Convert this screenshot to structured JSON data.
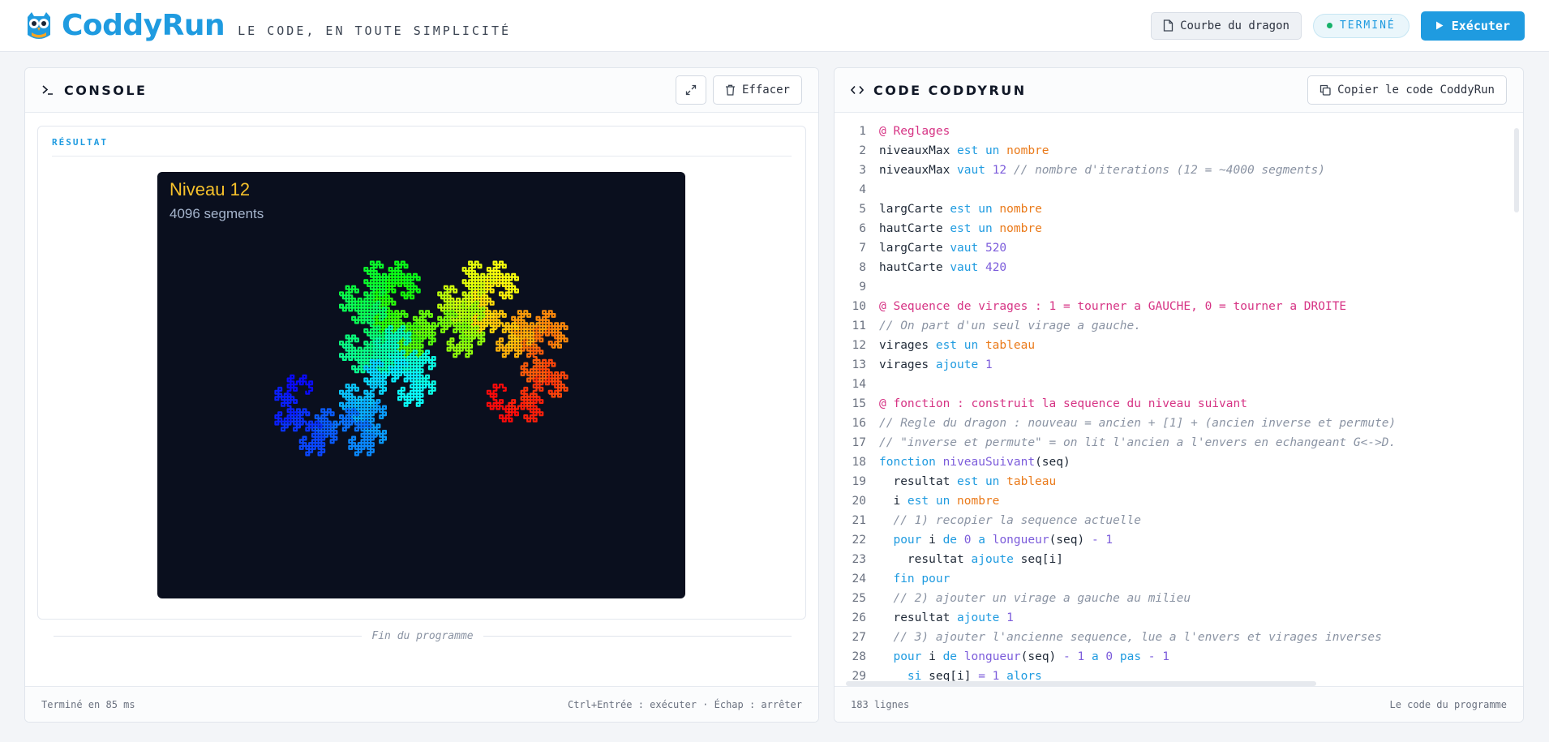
{
  "header": {
    "brand": "CoddyRun",
    "tagline": "LE CODE, EN TOUTE SIMPLICITÉ",
    "doc_name": "Courbe du dragon",
    "status": "TERMINÉ",
    "run_label": "Exécuter",
    "colors": {
      "accent": "#1f9be0",
      "status_dot": "#17b26a"
    }
  },
  "console": {
    "title": "CONSOLE",
    "clear_label": "Effacer",
    "result_label": "RÉSULTAT",
    "canvas": {
      "title": "Niveau 12",
      "subtitle": "4096 segments",
      "background": "#0a0f1e",
      "level": 12,
      "segments": 4096
    },
    "end_text": "Fin du programme",
    "footer_left": "Terminé en 85 ms",
    "footer_right": "Ctrl+Entrée : exécuter · Échap : arrêter"
  },
  "code": {
    "title": "CODE CODDYRUN",
    "copy_label": "Copier le code CoddyRun",
    "footer_left": "183 lignes",
    "footer_right": "Le code du programme",
    "lines": [
      {
        "n": "1",
        "parts": [
          [
            "dir",
            "@ Reglages"
          ]
        ]
      },
      {
        "n": "2",
        "parts": [
          [
            "tx",
            "niveauxMax "
          ],
          [
            "kw",
            "est un "
          ],
          [
            "ty",
            "nombre"
          ]
        ]
      },
      {
        "n": "3",
        "parts": [
          [
            "tx",
            "niveauxMax "
          ],
          [
            "kw",
            "vaut "
          ],
          [
            "num",
            "12 "
          ],
          [
            "cm",
            "// nombre d'iterations (12 = ~4000 segments)"
          ]
        ]
      },
      {
        "n": "4",
        "parts": []
      },
      {
        "n": "5",
        "parts": [
          [
            "tx",
            "largCarte "
          ],
          [
            "kw",
            "est un "
          ],
          [
            "ty",
            "nombre"
          ]
        ]
      },
      {
        "n": "6",
        "parts": [
          [
            "tx",
            "hautCarte "
          ],
          [
            "kw",
            "est un "
          ],
          [
            "ty",
            "nombre"
          ]
        ]
      },
      {
        "n": "7",
        "parts": [
          [
            "tx",
            "largCarte "
          ],
          [
            "kw",
            "vaut "
          ],
          [
            "num",
            "520"
          ]
        ]
      },
      {
        "n": "8",
        "parts": [
          [
            "tx",
            "hautCarte "
          ],
          [
            "kw",
            "vaut "
          ],
          [
            "num",
            "420"
          ]
        ]
      },
      {
        "n": "9",
        "parts": []
      },
      {
        "n": "10",
        "parts": [
          [
            "dir",
            "@ Sequence de virages : 1 = tourner a GAUCHE, 0 = tourner a DROITE"
          ]
        ]
      },
      {
        "n": "11",
        "parts": [
          [
            "cm",
            "// On part d'un seul virage a gauche."
          ]
        ]
      },
      {
        "n": "12",
        "parts": [
          [
            "tx",
            "virages "
          ],
          [
            "kw",
            "est un "
          ],
          [
            "ty",
            "tableau"
          ]
        ]
      },
      {
        "n": "13",
        "parts": [
          [
            "tx",
            "virages "
          ],
          [
            "kw",
            "ajoute "
          ],
          [
            "num",
            "1"
          ]
        ]
      },
      {
        "n": "14",
        "parts": []
      },
      {
        "n": "15",
        "parts": [
          [
            "dir",
            "@ fonction : construit la sequence du niveau suivant"
          ]
        ]
      },
      {
        "n": "16",
        "parts": [
          [
            "cm",
            "// Regle du dragon : nouveau = ancien + [1] + (ancien inverse et permute)"
          ]
        ]
      },
      {
        "n": "17",
        "parts": [
          [
            "cm",
            "// \"inverse et permute\" = on lit l'ancien a l'envers en echangeant G<->D."
          ]
        ]
      },
      {
        "n": "18",
        "parts": [
          [
            "kw",
            "fonction "
          ],
          [
            "fn",
            "niveauSuivant"
          ],
          [
            "tx",
            "(seq)"
          ]
        ]
      },
      {
        "n": "19",
        "parts": [
          [
            "tx",
            "  resultat "
          ],
          [
            "kw",
            "est un "
          ],
          [
            "ty",
            "tableau"
          ]
        ]
      },
      {
        "n": "20",
        "parts": [
          [
            "tx",
            "  i "
          ],
          [
            "kw",
            "est un "
          ],
          [
            "ty",
            "nombre"
          ]
        ]
      },
      {
        "n": "21",
        "parts": [
          [
            "cm",
            "  // 1) recopier la sequence actuelle"
          ]
        ]
      },
      {
        "n": "22",
        "parts": [
          [
            "kw",
            "  pour "
          ],
          [
            "tx",
            "i "
          ],
          [
            "kw",
            "de "
          ],
          [
            "num",
            "0 "
          ],
          [
            "kw",
            "a "
          ],
          [
            "fn",
            "longueur"
          ],
          [
            "tx",
            "(seq) "
          ],
          [
            "num",
            "- 1"
          ]
        ]
      },
      {
        "n": "23",
        "parts": [
          [
            "tx",
            "    resultat "
          ],
          [
            "kw",
            "ajoute "
          ],
          [
            "tx",
            "seq[i]"
          ]
        ]
      },
      {
        "n": "24",
        "parts": [
          [
            "kw",
            "  fin pour"
          ]
        ]
      },
      {
        "n": "25",
        "parts": [
          [
            "cm",
            "  // 2) ajouter un virage a gauche au milieu"
          ]
        ]
      },
      {
        "n": "26",
        "parts": [
          [
            "tx",
            "  resultat "
          ],
          [
            "kw",
            "ajoute "
          ],
          [
            "num",
            "1"
          ]
        ]
      },
      {
        "n": "27",
        "parts": [
          [
            "cm",
            "  // 3) ajouter l'ancienne sequence, lue a l'envers et virages inverses"
          ]
        ]
      },
      {
        "n": "28",
        "parts": [
          [
            "kw",
            "  pour "
          ],
          [
            "tx",
            "i "
          ],
          [
            "kw",
            "de "
          ],
          [
            "fn",
            "longueur"
          ],
          [
            "tx",
            "(seq) "
          ],
          [
            "num",
            "- 1 "
          ],
          [
            "kw",
            "a "
          ],
          [
            "num",
            "0 "
          ],
          [
            "kw",
            "pas "
          ],
          [
            "num",
            "- 1"
          ]
        ]
      },
      {
        "n": "29",
        "parts": [
          [
            "kw",
            "    si "
          ],
          [
            "tx",
            "seq[i] "
          ],
          [
            "num",
            "= 1 "
          ],
          [
            "kw",
            "alors"
          ]
        ]
      }
    ]
  }
}
